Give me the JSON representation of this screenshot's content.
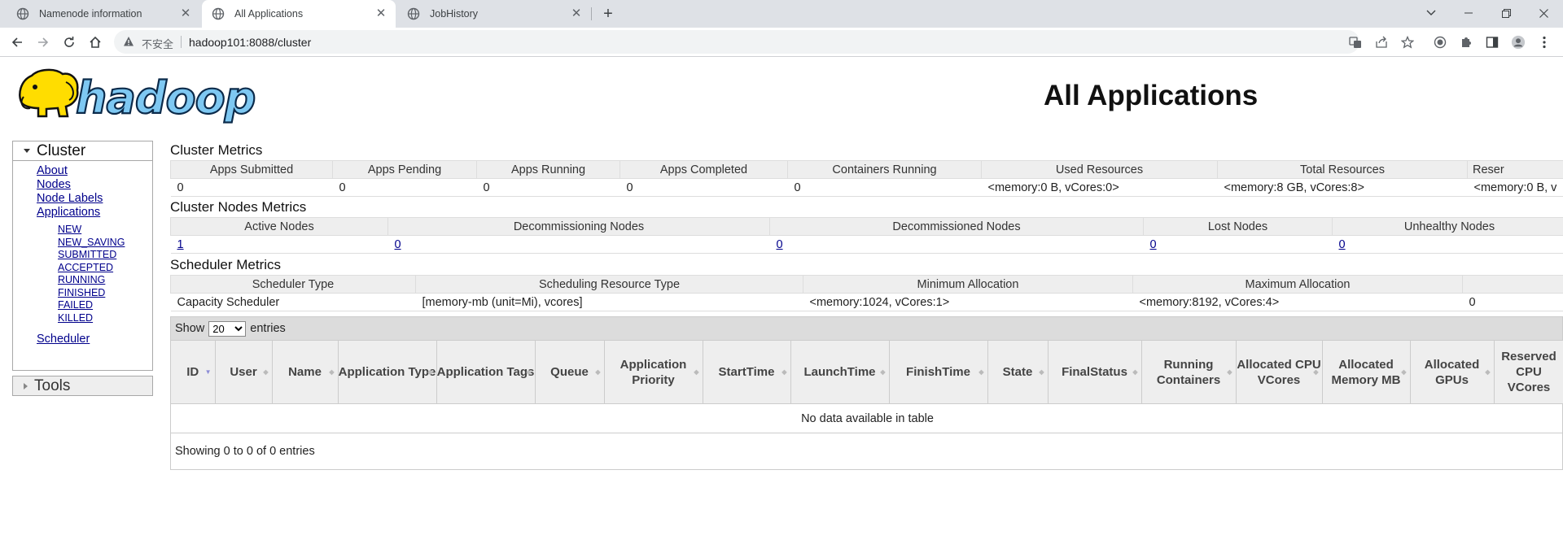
{
  "browser": {
    "tabs": [
      {
        "title": "Namenode information",
        "icon": "globe-icon"
      },
      {
        "title": "All Applications",
        "icon": "globe-icon",
        "active": true
      },
      {
        "title": "JobHistory",
        "icon": "globe-icon"
      }
    ],
    "omnibox": {
      "security_label": "不安全",
      "url": "hadoop101:8088/cluster"
    }
  },
  "header": {
    "logo_text": "hadoop",
    "title": "All Applications"
  },
  "nav": {
    "cluster": {
      "heading": "Cluster",
      "links": [
        "About",
        "Nodes",
        "Node Labels",
        "Applications"
      ],
      "app_states": [
        "NEW",
        "NEW_SAVING",
        "SUBMITTED",
        "ACCEPTED",
        "RUNNING",
        "FINISHED",
        "FAILED",
        "KILLED"
      ],
      "scheduler": "Scheduler"
    },
    "tools": {
      "heading": "Tools"
    }
  },
  "cluster_metrics": {
    "title": "Cluster Metrics",
    "headers": [
      "Apps Submitted",
      "Apps Pending",
      "Apps Running",
      "Apps Completed",
      "Containers Running",
      "Used Resources",
      "Total Resources",
      "Reser"
    ],
    "values": [
      "0",
      "0",
      "0",
      "0",
      "0",
      "<memory:0 B, vCores:0>",
      "<memory:8 GB, vCores:8>",
      "<memory:0 B, v"
    ]
  },
  "nodes_metrics": {
    "title": "Cluster Nodes Metrics",
    "headers": [
      "Active Nodes",
      "Decommissioning Nodes",
      "Decommissioned Nodes",
      "Lost Nodes",
      "Unhealthy Nodes"
    ],
    "values": [
      "1",
      "0",
      "0",
      "0",
      "0"
    ]
  },
  "scheduler_metrics": {
    "title": "Scheduler Metrics",
    "headers": [
      "Scheduler Type",
      "Scheduling Resource Type",
      "Minimum Allocation",
      "Maximum Allocation",
      ""
    ],
    "values": [
      "Capacity Scheduler",
      "[memory-mb (unit=Mi), vcores]",
      "<memory:1024, vCores:1>",
      "<memory:8192, vCores:4>",
      "0"
    ]
  },
  "applications": {
    "show_label": "Show",
    "page_size": "20",
    "entries_label": "entries",
    "columns": [
      "ID",
      "User",
      "Name",
      "Application Type",
      "Application Tags",
      "Queue",
      "Application Priority",
      "StartTime",
      "LaunchTime",
      "FinishTime",
      "State",
      "FinalStatus",
      "Running Containers",
      "Allocated CPU VCores",
      "Allocated Memory MB",
      "Allocated GPUs",
      "Reserved CPU VCores"
    ],
    "empty_message": "No data available in table",
    "footer": "Showing 0 to 0 of 0 entries"
  }
}
